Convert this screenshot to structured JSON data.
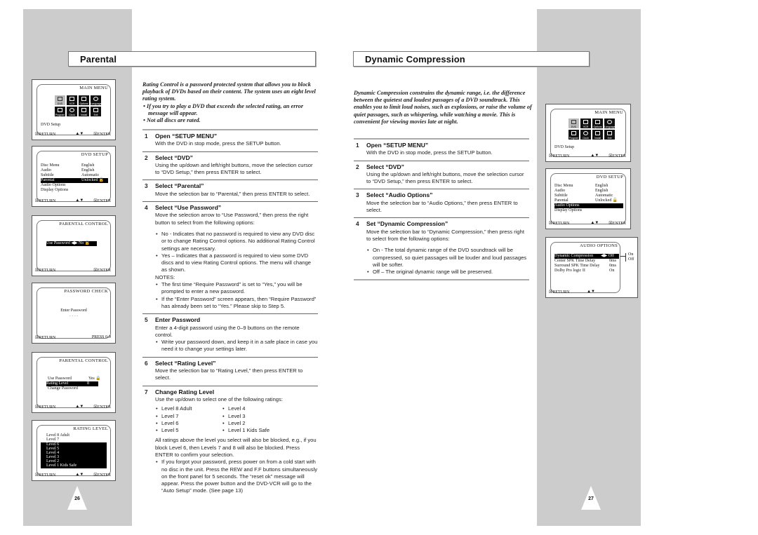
{
  "left_page": {
    "section_title": "Parental",
    "page_number": "26",
    "intro": "Rating Control is a password protected system that allows you to block playback of DVDs based on their content. The system uses an eight level rating system.",
    "intro_bullets": [
      "If you try to play a DVD that exceeds the selected rating, an error message will appear.",
      "Not all discs are rated."
    ],
    "steps": [
      {
        "num": "1",
        "title": "Open “SETUP MENU”",
        "text": "With the DVD in stop mode, press the SETUP button."
      },
      {
        "num": "2",
        "title": "Select “DVD”",
        "text": "Using the up/down and left/right buttons, move the selection cursor to “DVD Setup,” then press ENTER to select."
      },
      {
        "num": "3",
        "title": "Select “Parental”",
        "text": "Move the selection bar to “Parental,” then press ENTER to select."
      },
      {
        "num": "4",
        "title": "Select “Use Password”",
        "text": "Move the selection arrow to “Use Password,” then press the right button to select from the following options:",
        "bullets": [
          "No - Indicates that no password is required to view any DVD disc or to change Rating Control options. No additional Rating Control settings are necessary.",
          "Yes – Indicates that a password is required to view some DVD discs and to view Rating Control options. The menu will change as shown."
        ],
        "notes_label": "NOTES:",
        "notes": [
          "The first time “Require Password” is set to “Yes,” you will be prompted to enter a new password.",
          "If the “Enter Password” screen appears, then “Require Password” has already been set to “Yes.” Please skip to Step 5."
        ]
      },
      {
        "num": "5",
        "title": "Enter Password",
        "text": "Enter a 4-digit password using the 0–9 buttons on the remote control.",
        "bullets": [
          "Write your password down, and keep it in a safe place in case you need it to change your settings later."
        ]
      },
      {
        "num": "6",
        "title": "Select “Rating Level”",
        "text": "Move the selection bar to “Rating Level,” then press ENTER to select."
      },
      {
        "num": "7",
        "title": "Change Rating Level",
        "text": "Use the up/down to select one of the following ratings:",
        "ratings_left": [
          "Level 8 Adult",
          "Level 7",
          "Level 6",
          "Level 5"
        ],
        "ratings_right": [
          "Level 4",
          "Level 3",
          "Level 2",
          "Level 1 Kids Safe"
        ],
        "after": "All ratings above the level you select will also be blocked, e.g., if you block Level 6, then Levels 7 and 8 will also be blocked. Press ENTER to confirm your selection.",
        "bullets": [
          "If you forgot your password, press power on from a cold start with no disc in the unit. Press the REW and F.F buttons simultaneously on the front panel for 5 seconds. The “reset ok” message will appear. Press the power button and the  DVD-VCR will go to the “Auto Setup” mode. (See page 13)"
        ]
      }
    ]
  },
  "right_page": {
    "section_title": "Dynamic Compression",
    "page_number": "27",
    "intro": "Dynamic Compression constrains the dynamic range, i.e. the difference between the quietest and loudest passages of a DVD soundtrack. This enables you to limit loud noises, such as explosions, or raise the volume of quiet passages, such as whispering, while watching a movie. This is convenient for viewing movies late at night.",
    "steps": [
      {
        "num": "1",
        "title": "Open “SETUP MENU”",
        "text": "With the DVD in stop mode, press the SETUP button."
      },
      {
        "num": "2",
        "title": "Select “DVD”",
        "text": "Using the up/down and left/right buttons, move the selection cursor to “DVD Setup,” then press ENTER to select."
      },
      {
        "num": "3",
        "title": "Select “Audio Options”",
        "text": "Move the selection bar to “Audio Options,” then press ENTER to select."
      },
      {
        "num": "4",
        "title": "Set “Dynamic Compression”",
        "text": "Move the selection bar to “Dynamic Compression,” then press right to select from the following options:",
        "bullets": [
          "On - The total dynamic range of the DVD soundtrack will be compressed, so quiet passages will be louder and loud passages will be softer.",
          "Off – The original dynamic range will be preserved."
        ]
      }
    ]
  },
  "screens": {
    "common": {
      "return": "☒RETURN",
      "updown": "▲▼",
      "enter": "☒ENTER",
      "press": "PRESS 0-9"
    },
    "main_menu": {
      "title": "MAIN MENU",
      "icons": [
        "DVD",
        "VCR",
        "Options",
        "Language",
        "Program",
        "Clock",
        "Install",
        "Exit"
      ],
      "selected_label": "DVD Setup"
    },
    "dvd_setup": {
      "title": "DVD SETUP",
      "rows": [
        {
          "label": "Disc Menu",
          "value": "English"
        },
        {
          "label": "Audio",
          "value": "English"
        },
        {
          "label": "Subtitle",
          "value": "Automatic"
        },
        {
          "label": "Parental",
          "value": "Unlocked 🔓"
        },
        {
          "label": "Audio Options",
          "value": ""
        },
        {
          "label": "Display Options",
          "value": ""
        }
      ]
    },
    "parental_no": {
      "title": "PARENTAL CONTROL",
      "row": "Use Password   ◀▶  No 🔓"
    },
    "password_check": {
      "title": "PASSWORD CHECK",
      "label": "Enter Password",
      "mask": "- - - -"
    },
    "parental_yes": {
      "title": "PARENTAL CONTROL",
      "rows": [
        {
          "label": "Use Password",
          "value": "Yes 🔒"
        },
        {
          "label": "Rating Level",
          "value": "8"
        },
        {
          "label": "Change Password",
          "value": ""
        }
      ]
    },
    "rating_level": {
      "title": "RATING LEVEL",
      "levels": [
        "Level 8 Adult",
        "Level 7",
        "Level 6",
        "Level 5",
        "Level 4",
        "Level 3",
        "Level 2",
        "Level 1 Kids Safe"
      ]
    },
    "audio_options": {
      "title": "AUDIO OPTIONS",
      "rows": [
        {
          "label": "Dynamic Compression",
          "value": "◀▶ Off"
        },
        {
          "label": "Center SPK Time Delay",
          "value": "0ms"
        },
        {
          "label": "Surround SPK Time Delay",
          "value": "0ms"
        },
        {
          "label": "Dolby Pro logic II",
          "value": "On"
        }
      ],
      "side_options": [
        "On",
        "Off"
      ]
    }
  }
}
